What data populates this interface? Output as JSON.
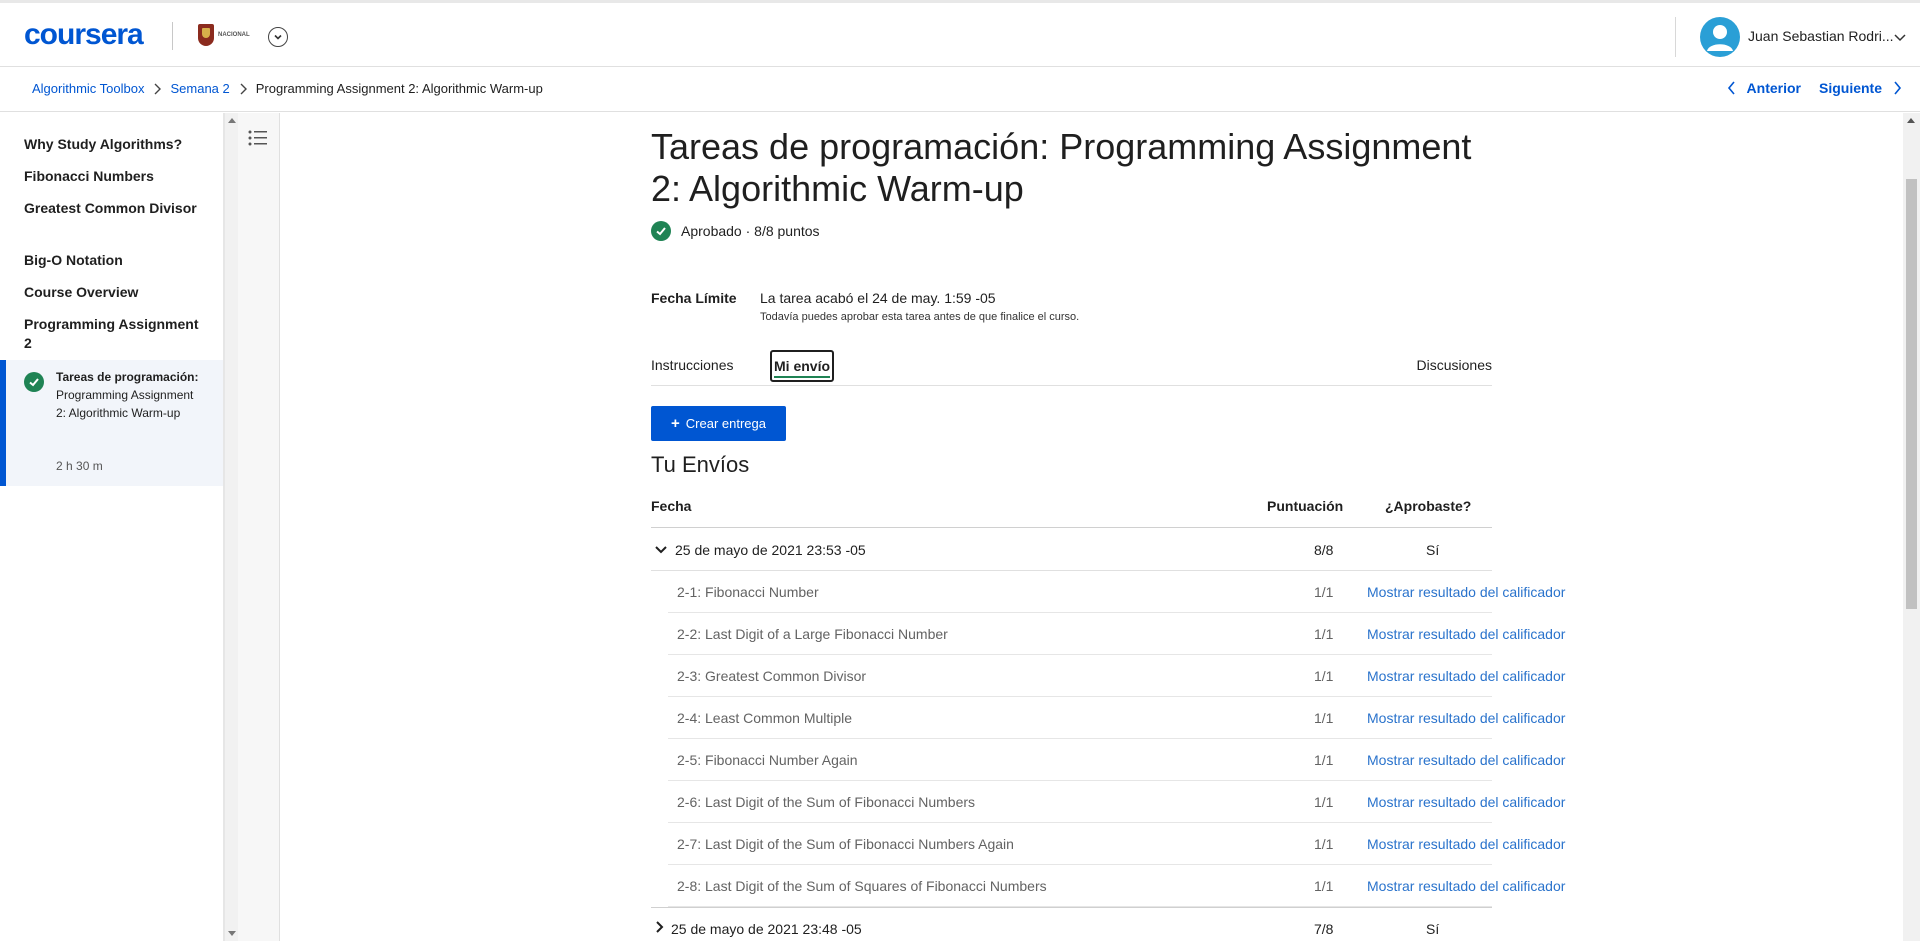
{
  "header": {
    "logo": "coursera",
    "university": "NACIONAL",
    "user_name": "Juan Sebastian Rodri..."
  },
  "breadcrumb": {
    "items": [
      "Algorithmic Toolbox",
      "Semana 2",
      "Programming Assignment 2: Algorithmic Warm-up"
    ],
    "prev_label": "Anterior",
    "next_label": "Siguiente"
  },
  "sidebar": {
    "items": [
      "Why Study Algorithms?",
      "Fibonacci Numbers",
      "Greatest Common Divisor",
      "Big-O Notation",
      "Course Overview",
      "Programming Assignment 2"
    ],
    "active": {
      "bold": "Tareas de programación:",
      "text": "Programming Assignment 2: Algorithmic Warm-up",
      "duration": "2 h 30 m"
    }
  },
  "main": {
    "title": "Tareas de programación: Programming Assignment 2: Algorithmic Warm-up",
    "status": "Aprobado · 8/8 puntos",
    "due_label": "Fecha Límite",
    "due_value": "La tarea acabó el 24 de may. 1:59 -05",
    "due_note": "Todavía puedes aprobar esta tarea antes de que finalice el curso.",
    "tabs": {
      "instructions": "Instrucciones",
      "my_submission": "Mi envío",
      "discussions": "Discusiones"
    },
    "create_button": "Crear entrega",
    "section_title": "Tu Envíos",
    "table_headers": {
      "date": "Fecha",
      "score": "Puntuación",
      "passed": "¿Aprobaste?"
    },
    "submissions": [
      {
        "date": "25 de mayo de 2021 23:53 -05",
        "score": "8/8",
        "passed": "Sí",
        "parts": [
          {
            "name": "2-1: Fibonacci Number",
            "score": "1/1",
            "link": "Mostrar resultado del calificador"
          },
          {
            "name": "2-2: Last Digit of a Large Fibonacci Number",
            "score": "1/1",
            "link": "Mostrar resultado del calificador"
          },
          {
            "name": "2-3: Greatest Common Divisor",
            "score": "1/1",
            "link": "Mostrar resultado del calificador"
          },
          {
            "name": "2-4: Least Common Multiple",
            "score": "1/1",
            "link": "Mostrar resultado del calificador"
          },
          {
            "name": "2-5: Fibonacci Number Again",
            "score": "1/1",
            "link": "Mostrar resultado del calificador"
          },
          {
            "name": "2-6: Last Digit of the Sum of Fibonacci Numbers",
            "score": "1/1",
            "link": "Mostrar resultado del calificador"
          },
          {
            "name": "2-7: Last Digit of the Sum of Fibonacci Numbers Again",
            "score": "1/1",
            "link": "Mostrar resultado del calificador"
          },
          {
            "name": "2-8: Last Digit of the Sum of Squares of Fibonacci Numbers",
            "score": "1/1",
            "link": "Mostrar resultado del calificador"
          }
        ]
      },
      {
        "date": "25 de mayo de 2021 23:48 -05",
        "score": "7/8",
        "passed": "Sí"
      }
    ]
  },
  "colors": {
    "brand": "#0056d2",
    "success": "#1f8354",
    "link": "#2a73cc"
  }
}
